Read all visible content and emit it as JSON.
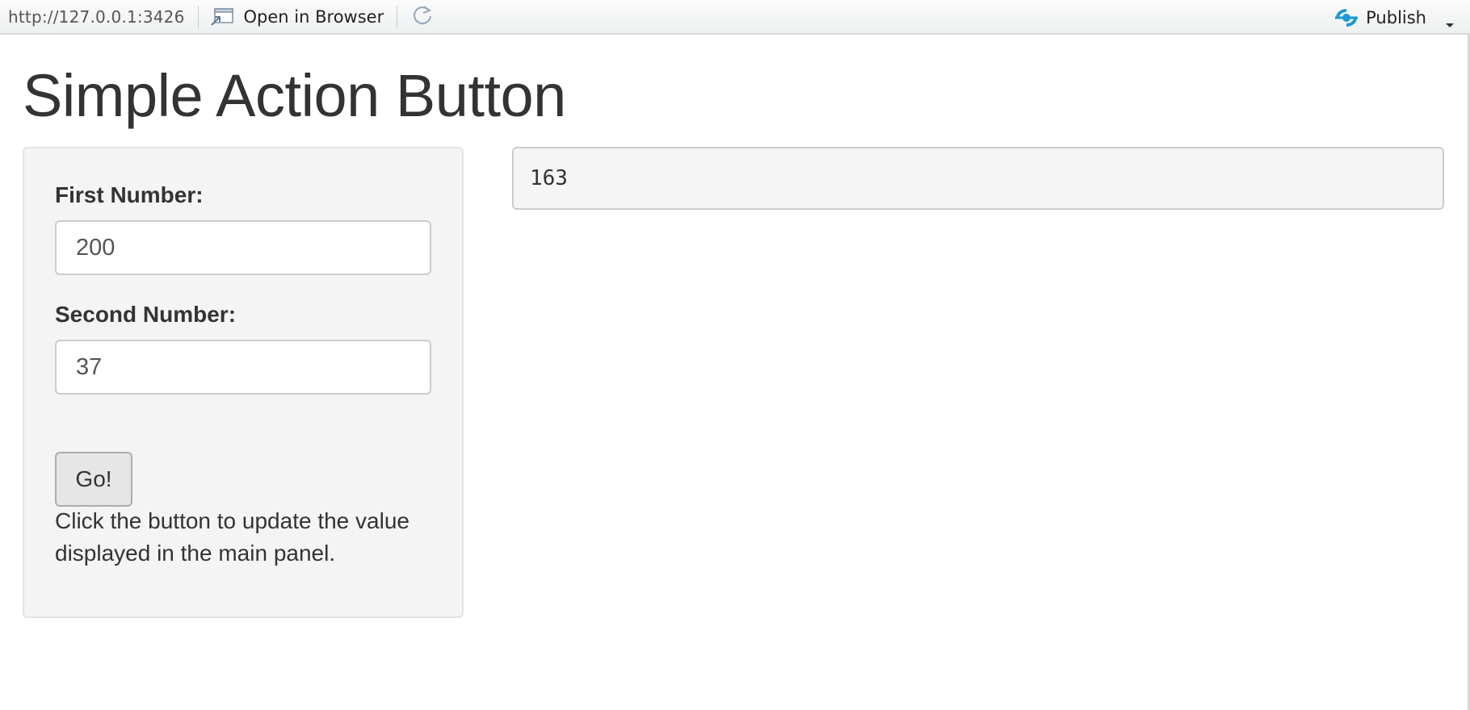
{
  "toolbar": {
    "url": "http://127.0.0.1:3426",
    "open_in_browser_label": "Open in Browser",
    "publish_label": "Publish",
    "icons": {
      "open_browser": "open-browser-icon",
      "refresh": "refresh-icon",
      "publish": "publish-icon",
      "dropdown": "chevron-down-icon"
    },
    "accent_color": "#1a9ad6"
  },
  "app": {
    "title": "Simple Action Button",
    "sidebar": {
      "first_number_label": "First Number:",
      "first_number_value": "200",
      "second_number_label": "Second Number:",
      "second_number_value": "37",
      "go_button_label": "Go!",
      "help_text": "Click the button to update the value displayed in the main panel."
    },
    "main": {
      "output_value": "163"
    }
  }
}
